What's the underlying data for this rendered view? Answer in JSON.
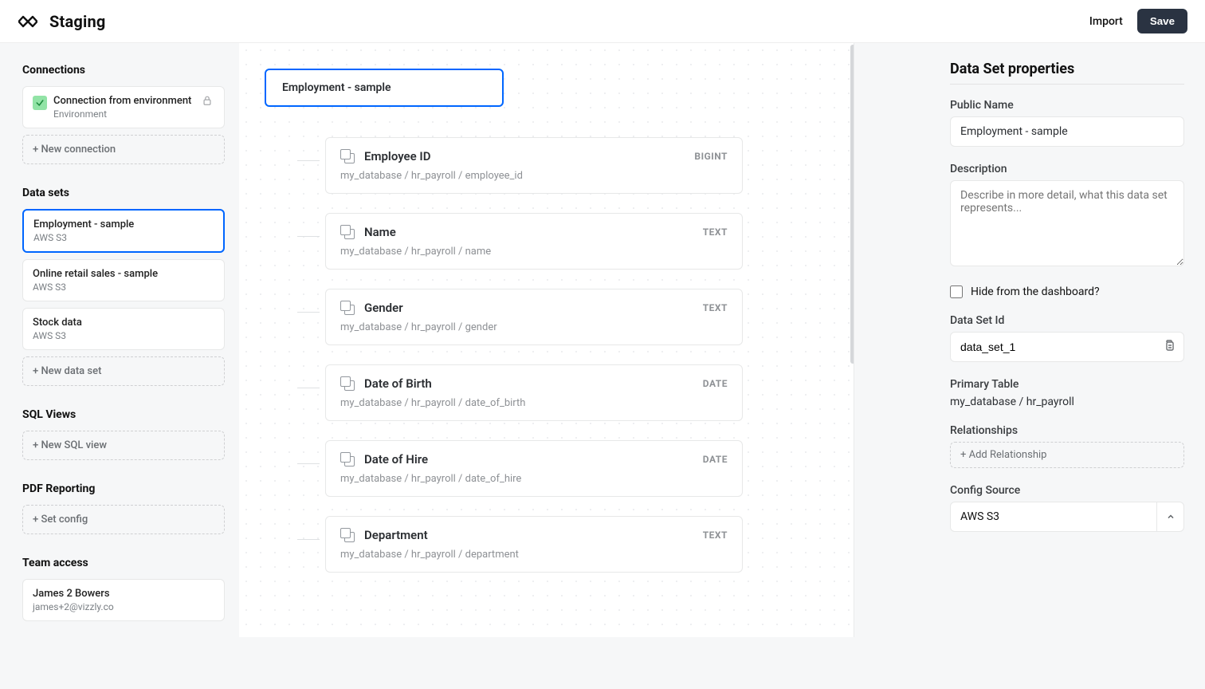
{
  "header": {
    "title": "Staging",
    "import_label": "Import",
    "save_label": "Save"
  },
  "sidebar": {
    "connections": {
      "heading": "Connections",
      "item": {
        "title": "Connection from environment",
        "subtitle": "Environment"
      },
      "add_label": "+ New connection"
    },
    "datasets": {
      "heading": "Data sets",
      "items": [
        {
          "name": "Employment - sample",
          "source": "AWS S3",
          "selected": true
        },
        {
          "name": "Online retail sales - sample",
          "source": "AWS S3",
          "selected": false
        },
        {
          "name": "Stock data",
          "source": "AWS S3",
          "selected": false
        }
      ],
      "add_label": "+ New data set"
    },
    "sqlviews": {
      "heading": "SQL Views",
      "add_label": "+ New SQL view"
    },
    "pdf": {
      "heading": "PDF Reporting",
      "add_label": "+ Set config"
    },
    "team": {
      "heading": "Team access",
      "name": "James 2 Bowers",
      "email": "james+2@vizzly.co"
    }
  },
  "canvas": {
    "dataset_title": "Employment - sample",
    "fields": [
      {
        "name": "Employee ID",
        "type": "BIGINT",
        "path": "my_database / hr_payroll / employee_id"
      },
      {
        "name": "Name",
        "type": "TEXT",
        "path": "my_database / hr_payroll / name"
      },
      {
        "name": "Gender",
        "type": "TEXT",
        "path": "my_database / hr_payroll / gender"
      },
      {
        "name": "Date of Birth",
        "type": "DATE",
        "path": "my_database / hr_payroll / date_of_birth"
      },
      {
        "name": "Date of Hire",
        "type": "DATE",
        "path": "my_database / hr_payroll / date_of_hire"
      },
      {
        "name": "Department",
        "type": "TEXT",
        "path": "my_database / hr_payroll / department"
      }
    ]
  },
  "props": {
    "heading": "Data Set properties",
    "public_name_label": "Public Name",
    "public_name_value": "Employment - sample",
    "description_label": "Description",
    "description_placeholder": "Describe in more detail, what this data set represents...",
    "hide_label": "Hide from the dashboard?",
    "id_label": "Data Set Id",
    "id_value": "data_set_1",
    "primary_table_label": "Primary Table",
    "primary_table_value": "my_database / hr_payroll",
    "relationships_label": "Relationships",
    "relationships_add": "+ Add Relationship",
    "config_source_label": "Config Source",
    "config_source_value": "AWS S3"
  }
}
